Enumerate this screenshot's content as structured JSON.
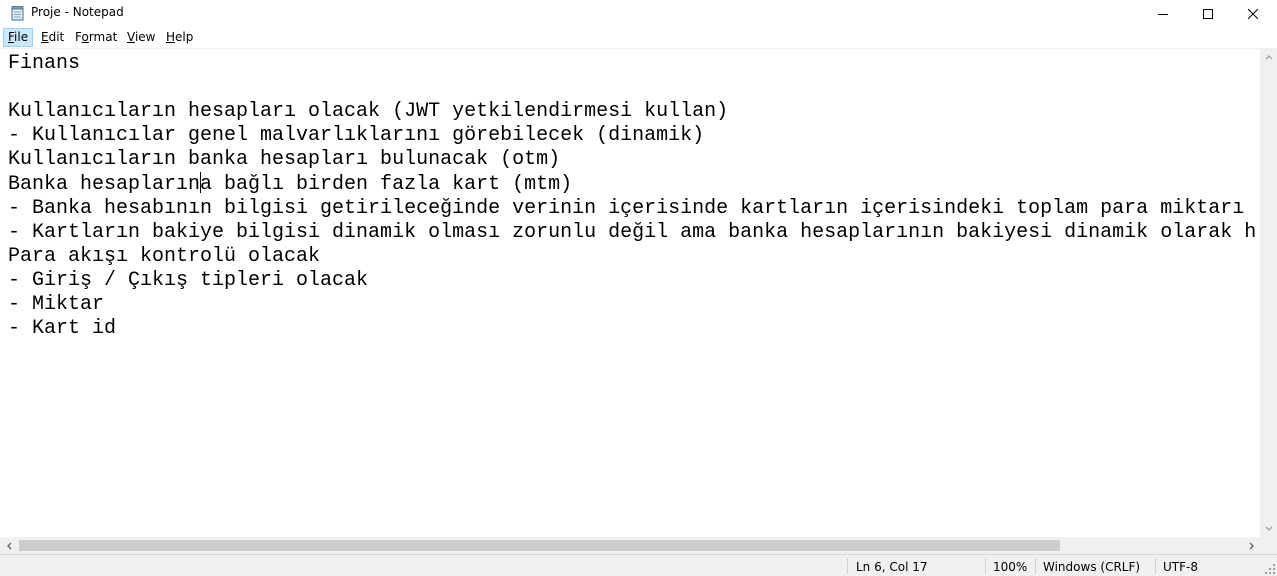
{
  "window": {
    "title": "Proje - Notepad",
    "icon": "notepad-icon",
    "controls": [
      "minimize-icon",
      "maximize-icon",
      "close-icon"
    ]
  },
  "menu": {
    "file": {
      "mnemonic": "F",
      "rest": "ile"
    },
    "edit": {
      "mnemonic": "E",
      "rest": "dit"
    },
    "format": {
      "mnemonic": "o",
      "pre": "F",
      "rest": "rmat"
    },
    "view": {
      "mnemonic": "V",
      "rest": "iew"
    },
    "help": {
      "mnemonic": "H",
      "rest": "elp"
    }
  },
  "editor": {
    "lines": [
      "Finans",
      "",
      "Kullanıcıların hesapları olacak (JWT yetkilendirmesi kullan)",
      "- Kullanıcılar genel malvarlıklarını görebilecek (dinamik)",
      "Kullanıcıların banka hesapları bulunacak (otm)",
      "Banka hesapların",
      "- Banka hesabının bilgisi getirileceğinde verinin içerisinde kartların içerisindeki toplam para miktarı",
      "- Kartların bakiye bilgisi dinamik olması zorunlu değil ama banka hesaplarının bakiyesi dinamik olarak h",
      "Para akışı kontrolü olacak",
      "- Giriş / Çıkış tipleri olacak",
      "- Miktar",
      "- Kart id"
    ],
    "line6_after_caret": "a bağlı birden fazla kart (mtm)"
  },
  "status": {
    "position": "Ln 6, Col 17",
    "zoom": "100%",
    "line_ending": "Windows (CRLF)",
    "encoding": "UTF-8"
  },
  "colors": {
    "menu_active_bg": "#cce8ff",
    "chrome_bg": "#f0f0f0",
    "scroll_thumb": "#cdcdcd"
  }
}
